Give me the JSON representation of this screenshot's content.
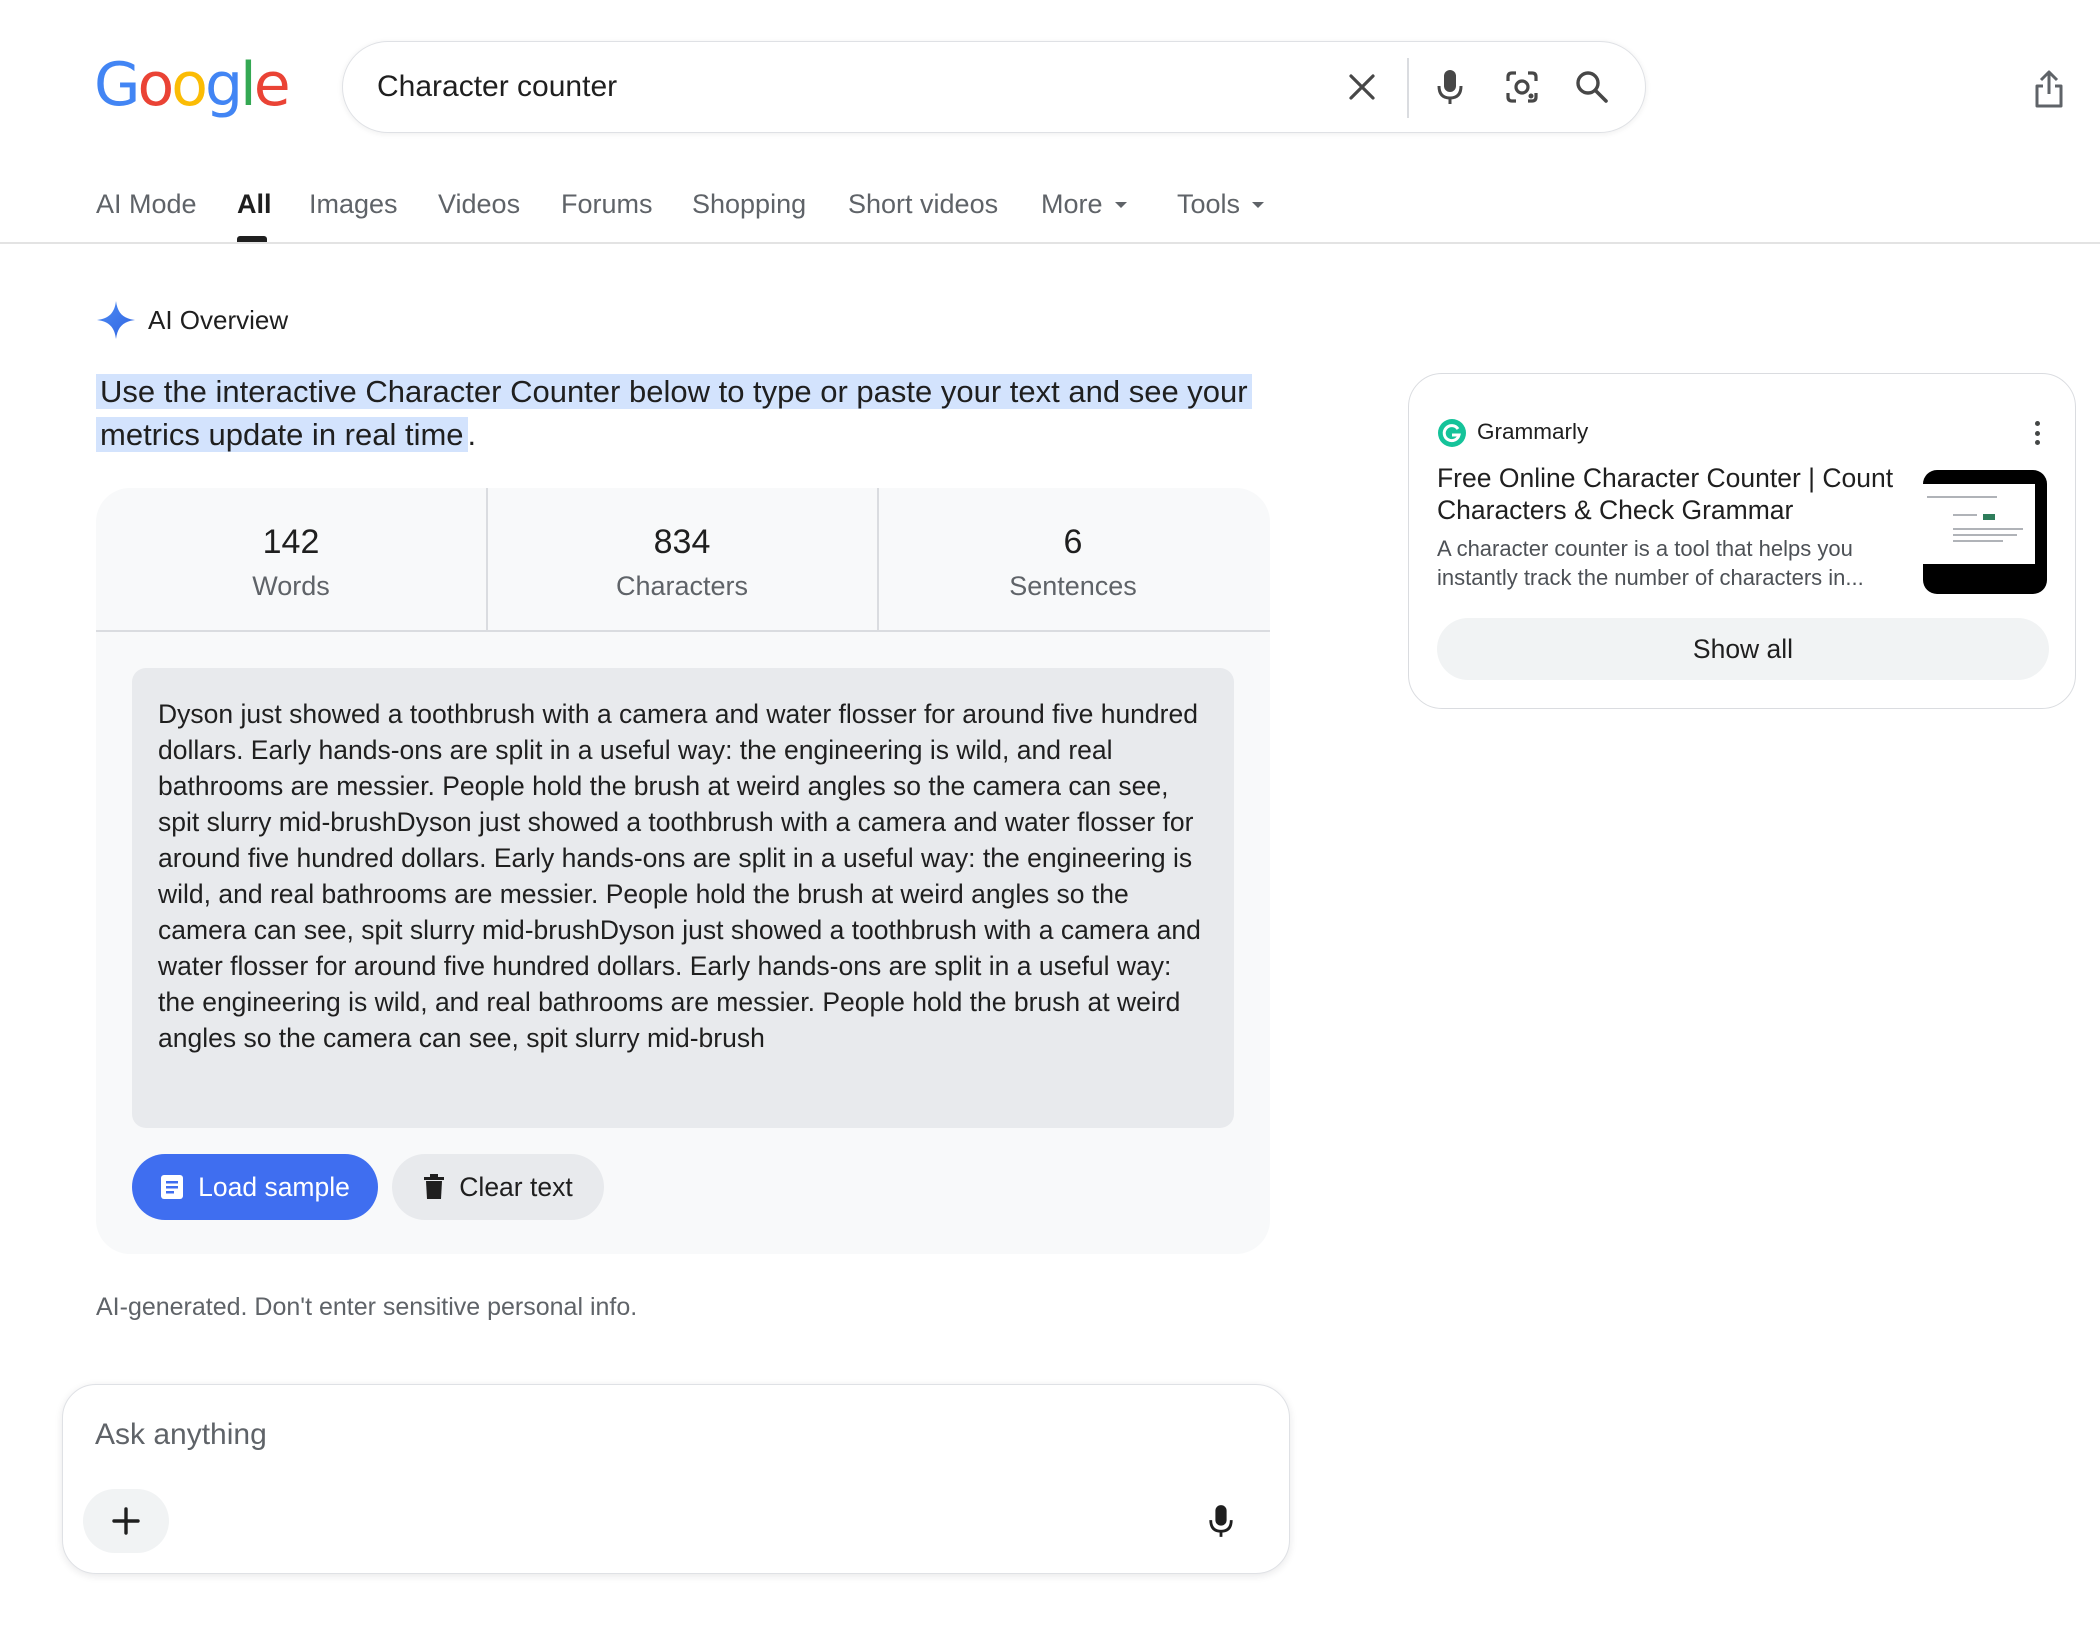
{
  "header": {
    "logo_letters": [
      {
        "char": "G",
        "color": "#4285F4"
      },
      {
        "char": "o",
        "color": "#EA4335"
      },
      {
        "char": "o",
        "color": "#FBBC05"
      },
      {
        "char": "g",
        "color": "#4285F4"
      },
      {
        "char": "l",
        "color": "#34A853"
      },
      {
        "char": "e",
        "color": "#EA4335"
      }
    ],
    "search_query": "Character counter",
    "icons": [
      "close-icon",
      "mic-icon",
      "lens-icon",
      "search-icon",
      "share-icon"
    ]
  },
  "tabs": [
    {
      "label": "AI Mode"
    },
    {
      "label": "All",
      "active": true
    },
    {
      "label": "Images"
    },
    {
      "label": "Videos"
    },
    {
      "label": "Forums"
    },
    {
      "label": "Shopping"
    },
    {
      "label": "Short videos"
    },
    {
      "label": "More",
      "dropdown": true
    },
    {
      "label": "Tools",
      "dropdown": true
    }
  ],
  "ai_overview": {
    "title": "AI Overview",
    "intro_highlight": "Use the interactive Character Counter below to type or paste your text and see your metrics update in real time",
    "intro_end": ".",
    "stats": [
      {
        "value": "142",
        "label": "Words"
      },
      {
        "value": "834",
        "label": "Characters"
      },
      {
        "value": "6",
        "label": "Sentences"
      }
    ],
    "text": "Dyson just showed a toothbrush with a camera and water flosser for around five hundred dollars. Early hands-ons are split in a useful way: the engineering is wild, and real bathrooms are messier. People hold the brush at weird angles so the camera can see, spit slurry mid-brushDyson just showed a toothbrush with a camera and water flosser for around five hundred dollars. Early hands-ons are split in a useful way: the engineering is wild, and real bathrooms are messier. People hold the brush at weird angles so the camera can see, spit slurry mid-brushDyson just showed a toothbrush with a camera and water flosser for around five hundred dollars. Early hands-ons are split in a useful way: the engineering is wild, and real bathrooms are messier. People hold the brush at weird angles so the camera can see, spit slurry mid-brush",
    "load_sample_label": "Load sample",
    "clear_text_label": "Clear text",
    "disclaimer": "AI-generated. Don't enter sensitive personal info.",
    "ask_placeholder": "Ask anything"
  },
  "source_card": {
    "site_name": "Grammarly",
    "title": "Free Online Character Counter | Count Characters & Check Grammar",
    "snippet": "A character counter is a tool that helps you instantly track the number of characters in...",
    "show_all_label": "Show all"
  },
  "colors": {
    "accent_blue": "#3f6ef0",
    "highlight": "#d3e3fd",
    "grammarly_green": "#15c39a"
  }
}
